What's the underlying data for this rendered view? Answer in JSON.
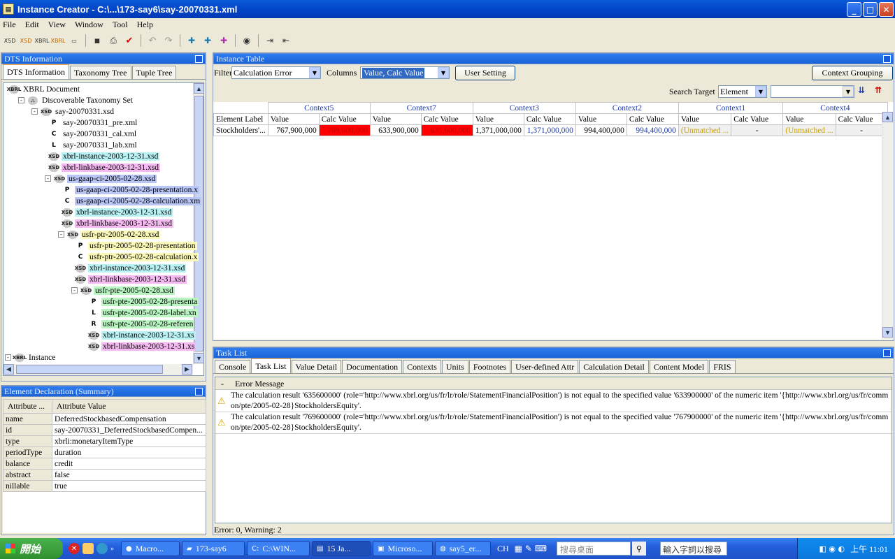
{
  "window": {
    "title": "Instance Creator - C:\\...\\173-say6\\say-20070331.xml",
    "app_icon": "instance-creator-icon",
    "min": "_",
    "max": "□",
    "close": "✕"
  },
  "menu": [
    "File",
    "Edit",
    "View",
    "Window",
    "Tool",
    "Help"
  ],
  "toolbar": {
    "icons": [
      "xsd-icon",
      "xsd-open-icon",
      "xbrl-icon",
      "xbrl-open-icon",
      "form-icon",
      "save-icon",
      "print-icon",
      "validate-icon",
      "undo-icon",
      "redo-icon",
      "add-element-icon",
      "add-context-icon",
      "add-unit-icon",
      "view-icon",
      "export-icon",
      "import-icon"
    ]
  },
  "dts": {
    "panel_title": "DTS Information",
    "tabs": [
      "DTS Information",
      "Taxonomy Tree",
      "Tuple Tree"
    ],
    "tree": [
      {
        "label": "XBRL Document",
        "icon": "XBRL",
        "hl": ""
      },
      {
        "label": "Discoverable Taxonomy Set",
        "icon": "DTS",
        "hl": ""
      },
      {
        "label": "say-20070331.xsd",
        "icon": "XSD",
        "hl": ""
      },
      {
        "label": "say-20070331_pre.xml",
        "icon": "P",
        "hl": ""
      },
      {
        "label": "say-20070331_cal.xml",
        "icon": "C",
        "hl": ""
      },
      {
        "label": "say-20070331_lab.xml",
        "icon": "L",
        "hl": ""
      },
      {
        "label": "xbrl-instance-2003-12-31.xsd",
        "icon": "XSD",
        "hl": "cyan"
      },
      {
        "label": "xbrl-linkbase-2003-12-31.xsd",
        "icon": "XSD",
        "hl": "pink"
      },
      {
        "label": "us-gaap-ci-2005-02-28.xsd",
        "icon": "XSD",
        "hl": "blue"
      },
      {
        "label": "us-gaap-ci-2005-02-28-presentation.x",
        "icon": "P",
        "hl": "blue"
      },
      {
        "label": "us-gaap-ci-2005-02-28-calculation.xm",
        "icon": "C",
        "hl": "blue"
      },
      {
        "label": "xbrl-instance-2003-12-31.xsd",
        "icon": "XSD",
        "hl": "cyan"
      },
      {
        "label": "xbrl-linkbase-2003-12-31.xsd",
        "icon": "XSD",
        "hl": "pink"
      },
      {
        "label": "usfr-ptr-2005-02-28.xsd",
        "icon": "XSD",
        "hl": "yellow"
      },
      {
        "label": "usfr-ptr-2005-02-28-presentation",
        "icon": "P",
        "hl": "yellow"
      },
      {
        "label": "usfr-ptr-2005-02-28-calculation.x",
        "icon": "C",
        "hl": "yellow"
      },
      {
        "label": "xbrl-instance-2003-12-31.xsd",
        "icon": "XSD",
        "hl": "cyan"
      },
      {
        "label": "xbrl-linkbase-2003-12-31.xsd",
        "icon": "XSD",
        "hl": "pink"
      },
      {
        "label": "usfr-pte-2005-02-28.xsd",
        "icon": "XSD",
        "hl": "green"
      },
      {
        "label": "usfr-pte-2005-02-28-presenta",
        "icon": "P",
        "hl": "green"
      },
      {
        "label": "usfr-pte-2005-02-28-label.xn",
        "icon": "L",
        "hl": "green"
      },
      {
        "label": "usfr-pte-2005-02-28-referen",
        "icon": "R",
        "hl": "green"
      },
      {
        "label": "xbrl-instance-2003-12-31.xs",
        "icon": "XSD",
        "hl": "cyan"
      },
      {
        "label": "xbrl-linkbase-2003-12-31.xs",
        "icon": "XSD",
        "hl": "pink"
      },
      {
        "label": "Instance",
        "icon": "XBRL",
        "hl": ""
      }
    ]
  },
  "element_decl": {
    "panel_title": "Element Declaration (Summary)",
    "col_attr": "Attribute ...",
    "col_value": "Attribute Value",
    "rows": [
      {
        "name": "name",
        "value": "DeferredStockbasedCompensation"
      },
      {
        "name": "id",
        "value": "say-20070331_DeferredStockbasedCompen..."
      },
      {
        "name": "type",
        "value": "xbrli:monetaryItemType"
      },
      {
        "name": "periodType",
        "value": "duration"
      },
      {
        "name": "balance",
        "value": "credit"
      },
      {
        "name": "abstract",
        "value": "false"
      },
      {
        "name": "nillable",
        "value": "true"
      }
    ]
  },
  "instance": {
    "panel_title": "Instance Table",
    "filter_label": "Filter",
    "filter_value": "Calculation Error",
    "columns_label": "Columns",
    "columns_value": "Value, Calc Value",
    "user_setting": "User Setting",
    "context_grouping": "Context Grouping",
    "search_target_label": "Search Target",
    "search_target_value": "Element",
    "search_text": "",
    "element_label_header": "Element Label",
    "contexts": [
      "Context5",
      "Context7",
      "Context3",
      "Context2",
      "Context1",
      "Context4"
    ],
    "value_header": "Value",
    "calc_header": "Calc Value",
    "row_label": "Stockholders'...",
    "cells": [
      {
        "value": "767,900,000",
        "calc": "769,600,000",
        "calc_error": true
      },
      {
        "value": "633,900,000",
        "calc": "635,600,000",
        "calc_error": true
      },
      {
        "value": "1,371,000,000",
        "calc": "1,371,000,000",
        "calc_error": false
      },
      {
        "value": "994,400,000",
        "calc": "994,400,000",
        "calc_error": false
      },
      {
        "value": "(Unmatched ...",
        "calc": "-",
        "calc_error": false
      },
      {
        "value": "(Unmatched ...",
        "calc": "-",
        "calc_error": false
      }
    ],
    "colors": {
      "error": "#ff0000",
      "calc_text": "#1d3aa8",
      "unmatched": "#c8a000"
    }
  },
  "tasklist": {
    "panel_title": "Task List",
    "tabs": [
      "Console",
      "Task List",
      "Value Detail",
      "Documentation",
      "Contexts",
      "Units",
      "Footnotes",
      "User-defined Attr",
      "Calculation Detail",
      "Content Model",
      "FRIS"
    ],
    "active_tab": "Task List",
    "col_dash": "-",
    "col_msg": "Error Message",
    "messages": [
      {
        "line1": "The calculation result '635600000' (role='http://www.xbrl.org/us/fr/lr/role/StatementFinancialPosition') is not equal to the specified value '633900000' of the numeric item '{http://www.xbrl.org/us/fr/comm",
        "line2": "on/pte/2005-02-28}StockholdersEquity'."
      },
      {
        "line1": "The calculation result '769600000' (role='http://www.xbrl.org/us/fr/lr/role/StatementFinancialPosition') is not equal to the specified value '767900000' of the numeric item '{http://www.xbrl.org/us/fr/comm",
        "line2": "on/pte/2005-02-28}StockholdersEquity'."
      }
    ],
    "status": "Error: 0, Warning: 2"
  },
  "taskbar": {
    "start": "開始",
    "tasks": [
      "Macro...",
      "173-say6",
      "C:\\WIN...",
      "15 Ja...",
      "Microso...",
      "say5_er..."
    ],
    "lang": "CH",
    "search_placeholder": "搜尋桌面",
    "input_placeholder": "輸入字詞以搜尋",
    "clock": "上午 11:01"
  }
}
